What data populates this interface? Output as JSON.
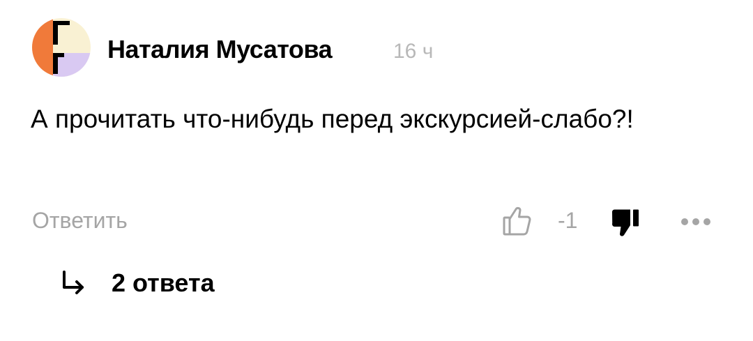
{
  "comment": {
    "author_name": "Наталия Мусатова",
    "timestamp": "16 ч",
    "text": "А прочитать что-нибудь перед экскурсией-слабо?!",
    "avatar_icon": "abstract-colored-avatar",
    "avatar_colors": {
      "orange": "#f07a3a",
      "cream": "#f9f1d3",
      "lavender": "#d9c9f2",
      "black": "#000000"
    }
  },
  "actions": {
    "reply_label": "Ответить",
    "like_icon": "thumbs-up-outline-icon",
    "rating": "-1",
    "dislike_icon": "thumbs-down-filled-icon",
    "more_icon": "more-dots-icon"
  },
  "replies": {
    "arrow_icon": "reply-arrow-icon",
    "count_label": "2 ответа"
  },
  "colors": {
    "text": "#000000",
    "muted": "#a5a5a5",
    "timestamp": "#b8b8b8"
  }
}
